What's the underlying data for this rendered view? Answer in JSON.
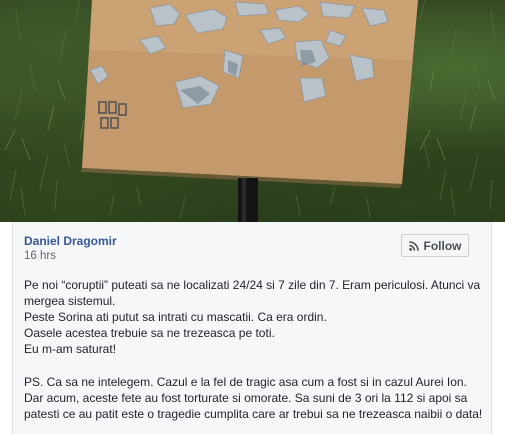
{
  "post": {
    "author_name": "Daniel Dragomir",
    "timestamp": "16 hrs",
    "follow_label": "Follow",
    "follow_icon": "rss-icon",
    "paragraph_1_lines": [
      "Pe noi “coruptii” puteati sa ne localizati 24/24 si 7 zile din 7. Eram periculosi. Atunci va",
      "mergea sistemul.",
      "Peste Sorina ati putut sa intrati cu mascatii. Ca era ordin.",
      "Oasele acestea trebuie sa ne trezeasca pe toti.",
      "Eu m-am saturat!"
    ],
    "paragraph_2_lines": [
      "PS. Ca sa ne intelegem. Cazul e la fel de tragic asa cum a fost si in cazul Aurei Ion.",
      "Dar acum, aceste fete au fost torturate si omorate. Sa suni de 3 ori la 112 si apoi sa",
      "patesti ce au patit este o tragedie cumplita care ar trebui sa ne trezeasca naibii o data!"
    ]
  },
  "colors": {
    "author_link": "#365899",
    "body_text": "#1d2129",
    "meta_text": "#616770",
    "card_background": "#f6f7f9"
  }
}
